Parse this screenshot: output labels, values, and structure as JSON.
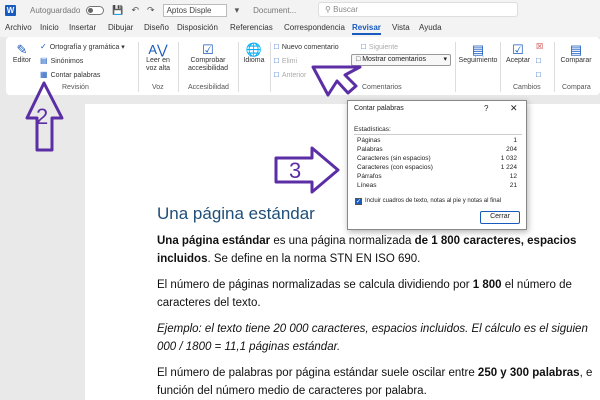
{
  "titlebar": {
    "app_icon": "W",
    "autosave_label": "Autoguardado",
    "font_name": "Aptos Disple",
    "document_name": "Document...",
    "search_placeholder": "Buscar"
  },
  "menu": {
    "tabs": [
      {
        "label": "Archivo"
      },
      {
        "label": "Inicio"
      },
      {
        "label": "Insertar"
      },
      {
        "label": "Dibujar"
      },
      {
        "label": "Diseño"
      },
      {
        "label": "Disposición"
      },
      {
        "label": "Referencias"
      },
      {
        "label": "Correspondencia"
      },
      {
        "label": "Revisar"
      },
      {
        "label": "Vista"
      },
      {
        "label": "Ayuda"
      }
    ],
    "active_tab": "Revisar"
  },
  "ribbon": {
    "editor": "Editor",
    "spelling": "Ortografía y gramática",
    "synonyms": "Sinónimos",
    "word_count": "Contar palabras",
    "group_revision": "Revisión",
    "read_aloud": "Leer en voz alta",
    "group_voice": "Voz",
    "check_access": "Comprobar accesibilidad",
    "group_access": "Accesibilidad",
    "language": "Idioma",
    "new_comment": "Nuevo comentario",
    "delete": "Elimi",
    "previous": "Anterior",
    "next": "Siguiente",
    "show_comments": "Mostrar comentarios",
    "group_comments": "Comentarios",
    "tracking": "Seguimiento",
    "accept": "Aceptar",
    "group_changes": "Cambios",
    "compare": "Comparar",
    "group_compare": "Compara"
  },
  "document": {
    "heading": "Una página estándar",
    "p1_bold1": "Una página estándar",
    "p1_text1": " es una página normalizada ",
    "p1_bold2": "de 1 800 caracteres, espacios",
    "p1_bold3": "incluidos",
    "p1_text2": ". Se define en la norma STN EN ISO 690.",
    "p2_text1": "El número de páginas normalizadas se calcula dividiendo por ",
    "p2_bold": "1 800",
    "p2_text2": " el número de",
    "p2_text3": "caracteres del texto.",
    "p3_line1": "Ejemplo: el texto tiene 20 000 caracteres, espacios incluidos. El cálculo es el siguien",
    "p3_line2": "000 / 1800 = 11,1 páginas estándar.",
    "p4_text1": "El número de palabras por página estándar suele oscilar entre ",
    "p4_bold": "250 y 300 palabras",
    "p4_text2": ", e",
    "p4_text3": "función del número medio de caracteres por palabra."
  },
  "dialog": {
    "title": "Contar palabras",
    "help": "?",
    "close": "✕",
    "stats_label": "Estadísticas:",
    "stats": [
      {
        "label": "Páginas",
        "value": "1"
      },
      {
        "label": "Palabras",
        "value": "204"
      },
      {
        "label": "Caracteres (sin espacios)",
        "value": "1 032"
      },
      {
        "label": "Caracteres (con espacios)",
        "value": "1 224"
      },
      {
        "label": "Párrafos",
        "value": "12"
      },
      {
        "label": "Líneas",
        "value": "21"
      }
    ],
    "checkbox_label": "Incluir cuadros de texto, notas al pie y notas al final",
    "checkbox_checked": true,
    "close_button": "Cerrar"
  },
  "annotations": {
    "arrow_color": "#5b2ea6",
    "labels": [
      "2",
      "3"
    ]
  }
}
